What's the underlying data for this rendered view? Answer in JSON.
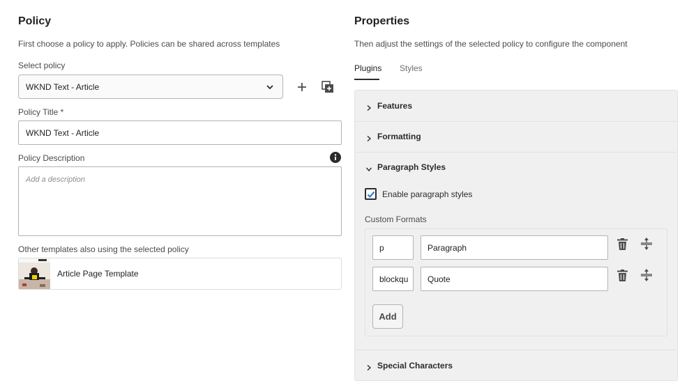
{
  "left": {
    "heading": "Policy",
    "description": "First choose a policy to apply. Policies can be shared across templates",
    "select_label": "Select policy",
    "select_value": "WKND Text - Article",
    "title_label": "Policy Title *",
    "title_value": "WKND Text - Article",
    "desc_label": "Policy Description",
    "desc_placeholder": "Add a description",
    "other_label": "Other templates also using the selected policy",
    "template_name": "Article Page Template"
  },
  "right": {
    "heading": "Properties",
    "description": "Then adjust the settings of the selected policy to configure the component",
    "tabs": [
      "Plugins",
      "Styles"
    ],
    "sections": {
      "features": "Features",
      "formatting": "Formatting",
      "paragraph_styles": "Paragraph Styles",
      "special_characters": "Special Characters"
    },
    "enable_label": "Enable paragraph styles",
    "enable_checked": true,
    "custom_formats_label": "Custom Formats",
    "formats": [
      {
        "tag": "p",
        "name": "Paragraph"
      },
      {
        "tag": "blockqu",
        "name": "Quote"
      }
    ],
    "add_label": "Add"
  },
  "colors": {
    "accent": "#2680eb",
    "text": "#2c2c2c",
    "panel": "#f0f0f0"
  }
}
